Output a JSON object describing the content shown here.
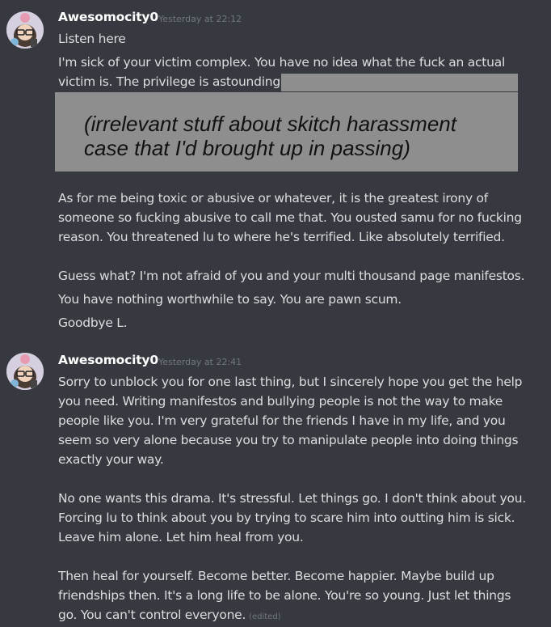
{
  "messages": [
    {
      "author": "Awesomocity0",
      "timestamp": "Yesterday at 22:12",
      "lines": [
        "Listen here",
        "I'm sick of your victim complex. You have no idea what the fuck an actual",
        "victim is. The privilege is astounding.",
        "As for me being toxic or abusive or whatever, it is the greatest irony of",
        "someone so fucking abusive to call me that. You ousted samu for no fucking",
        "reason. You threatened lu to where he's terrified. Like absolutely terrified.",
        "Guess what? I'm not afraid of you and your multi thousand page manifestos.",
        "You have nothing worthwhile to say. You are pawn scum.",
        "Goodbye L."
      ],
      "redaction_note": [
        "(irrelevant stuff about skitch harassment",
        "case that I'd brought up in passing)"
      ]
    },
    {
      "author": "Awesomocity0",
      "timestamp": "Yesterday at 22:41",
      "lines": [
        "Sorry to unblock you for one last thing, but I sincerely hope you get the help",
        "you need. Writing manifestos and bullying people is not the way to make",
        "people like you. I'm very grateful for the friends I have in my life, and you",
        "seem so very alone because you try to manipulate people into doing things",
        "exactly your way.",
        "No one wants this drama. It's stressful. Let things go. I don't think about you.",
        "Forcing lu to think about you by trying to scare him into outting him is sick.",
        "Leave him alone. Let him heal from you.",
        "Then heal for yourself. Become better. Become happier. Maybe build up",
        "friendships then. It's a long life to be alone. You're so young. Just let things",
        "go. You can't control everyone."
      ],
      "edited_label": "(edited)"
    }
  ]
}
